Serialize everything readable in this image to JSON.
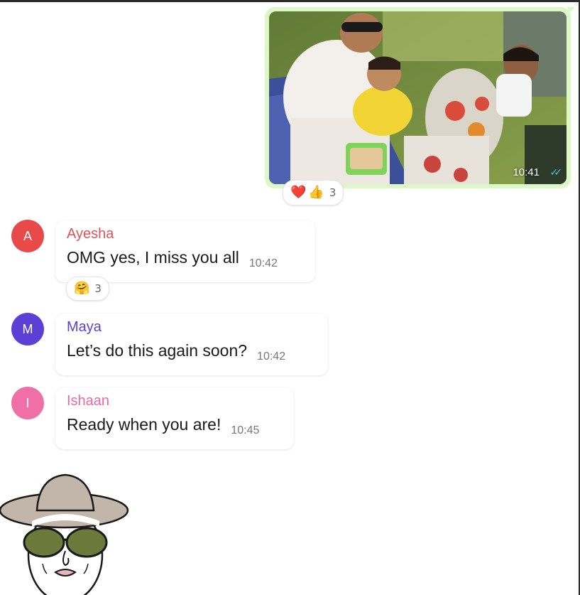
{
  "outgoing": {
    "time": "10:41",
    "ticks": "✓✓",
    "reactions": {
      "emoji1": "❤️",
      "emoji2": "👍",
      "count": "3"
    }
  },
  "messages": [
    {
      "avatar_letter": "A",
      "avatar_color": "#e84a4a",
      "sender": "Ayesha",
      "sender_color": "#e0545a",
      "text": "OMG yes, I miss you all",
      "time": "10:42",
      "reaction": {
        "emoji": "🤗",
        "count": "3"
      }
    },
    {
      "avatar_letter": "M",
      "avatar_color": "#5b3fd6",
      "sender": "Maya",
      "sender_color": "#5b3fd6",
      "text": "Let’s do this again soon?",
      "time": "10:42"
    },
    {
      "avatar_letter": "I",
      "avatar_color": "#f06fa7",
      "sender": "Ishaan",
      "sender_color": "#e76aa2",
      "text": "Ready when you are!",
      "time": "10:45"
    }
  ],
  "colors": {
    "outgoing_bubble": "#dcf8c6",
    "tick_blue": "#53bdeb"
  },
  "sticker": "woman-with-hat-and-sunglasses-sticker"
}
